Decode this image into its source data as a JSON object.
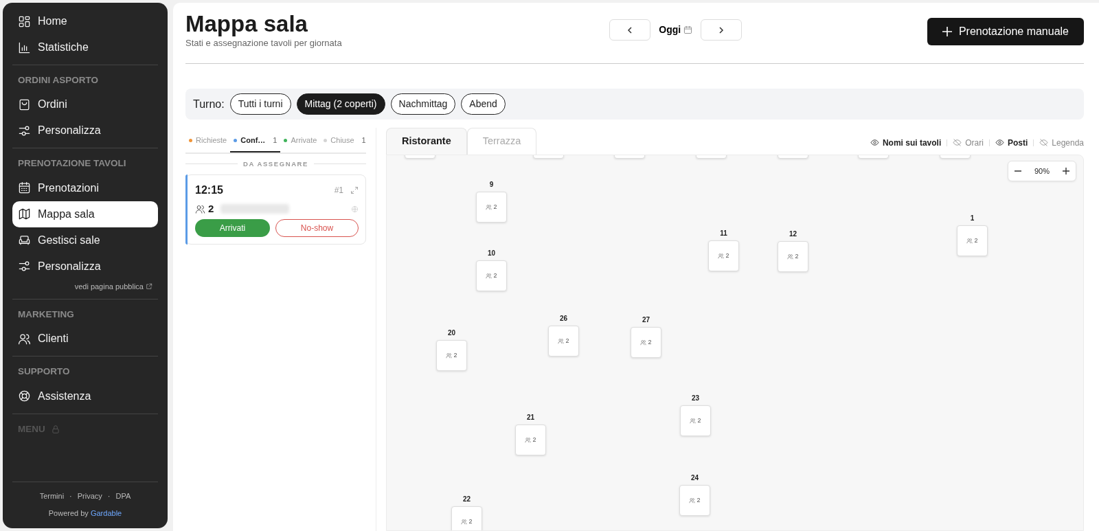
{
  "sidebar": {
    "sections": [
      {
        "items": [
          {
            "label": "Home",
            "selected": false
          },
          {
            "label": "Statistiche",
            "selected": false
          }
        ]
      },
      {
        "title": "ORDINI ASPORTO",
        "items": [
          {
            "label": "Ordini",
            "selected": false
          },
          {
            "label": "Personalizza",
            "selected": false
          }
        ]
      },
      {
        "title": "PRENOTAZIONE TAVOLI",
        "items": [
          {
            "label": "Prenotazioni",
            "selected": false
          },
          {
            "label": "Mappa sala",
            "selected": true
          },
          {
            "label": "Gestisci sale",
            "selected": false
          },
          {
            "label": "Personalizza",
            "selected": false
          }
        ],
        "link": "vedi pagina pubblica"
      },
      {
        "title": "MARKETING",
        "items": [
          {
            "label": "Clienti",
            "selected": false
          }
        ]
      },
      {
        "title": "SUPPORTO",
        "items": [
          {
            "label": "Assistenza",
            "selected": false
          }
        ]
      },
      {
        "title": "MENU",
        "locked": true
      }
    ],
    "footer_links": [
      "Termini",
      "Privacy",
      "DPA"
    ],
    "footer_separator": "·",
    "powered_by": "Powered by",
    "brand": "Gardable"
  },
  "header": {
    "title": "Mappa sala",
    "subtitle": "Stati e assegnazione tavoli per giornata",
    "date_label": "Oggi",
    "primary_button": "Prenotazione manuale"
  },
  "shift_filter": {
    "label": "Turno:",
    "options": [
      {
        "label": "Tutti i turni",
        "selected": false
      },
      {
        "label": "Mittag (2 coperti)",
        "selected": true
      },
      {
        "label": "Nachmittag",
        "selected": false
      },
      {
        "label": "Abend",
        "selected": false
      }
    ]
  },
  "status_tabs": [
    {
      "label": "Richieste",
      "color": "#f0953a",
      "selected": false
    },
    {
      "label": "Conf…",
      "color": "#5b9be6",
      "count": "1",
      "selected": true
    },
    {
      "label": "Arrivate",
      "color": "#3fb35a",
      "selected": false
    },
    {
      "label": "Chiuse",
      "color": "#d4d4d4",
      "count": "1",
      "selected": false
    }
  ],
  "section_label": "DA ASSEGNARE",
  "bookings": [
    {
      "time": "12:15",
      "number": "#1",
      "guests": "2",
      "color": "#5b9be6",
      "buttons": [
        "Arrivati",
        "No-show"
      ]
    }
  ],
  "room_tabs": [
    {
      "label": "Ristorante",
      "selected": true
    },
    {
      "label": "Terrazza",
      "selected": false
    }
  ],
  "view_toggles": [
    {
      "label": "Nomi sui tavoli",
      "on": true
    },
    {
      "label": "Orari",
      "on": false
    },
    {
      "label": "Posti",
      "on": true
    },
    {
      "label": "Legenda",
      "on": false
    }
  ],
  "zoom": "90%",
  "tables": [
    {
      "number": "9",
      "seats": "2"
    },
    {
      "number": "10",
      "seats": "2"
    },
    {
      "number": "11",
      "seats": "2"
    },
    {
      "number": "12",
      "seats": "2"
    },
    {
      "number": "1",
      "seats": "2"
    },
    {
      "number": "20",
      "seats": "2"
    },
    {
      "number": "26",
      "seats": "2"
    },
    {
      "number": "27",
      "seats": "2"
    },
    {
      "number": "21",
      "seats": "2"
    },
    {
      "number": "23",
      "seats": "2"
    },
    {
      "number": "24",
      "seats": "2"
    },
    {
      "number": "22",
      "seats": "2"
    }
  ]
}
